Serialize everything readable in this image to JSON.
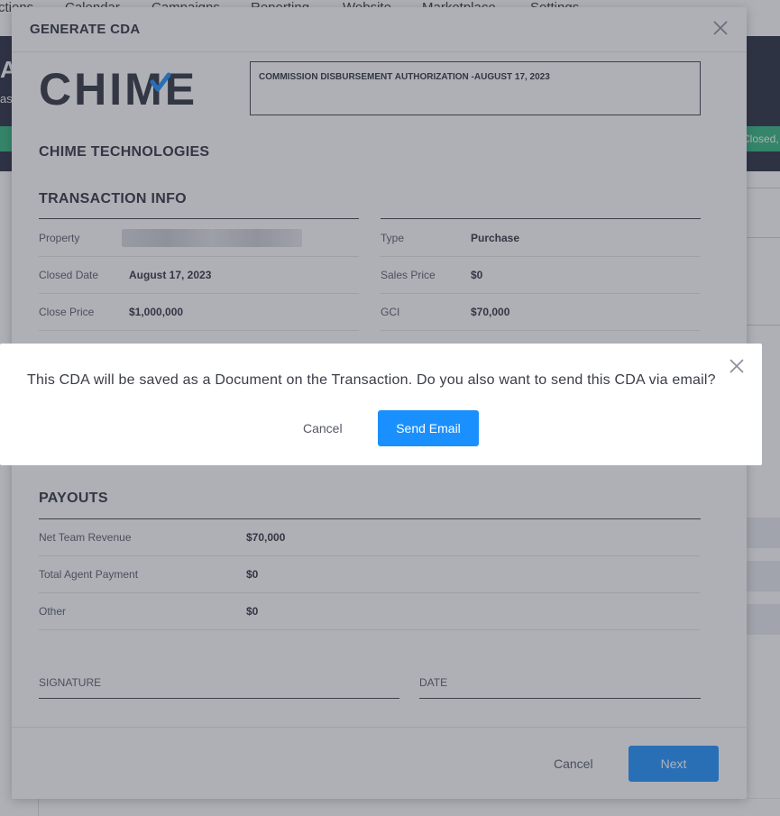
{
  "background": {
    "nav_items": [
      "ctions",
      "Calendar",
      "Campaigns",
      "Reporting",
      "Website",
      "Marketplace",
      "Settings"
    ],
    "header_letter": "A",
    "header_sub": "as",
    "status_badge": "Closed,"
  },
  "modal": {
    "title": "GENERATE CDA",
    "logo_text": "CHIME",
    "cda_heading": "COMMISSION DISBURSEMENT AUTHORIZATION -AUGUST 17, 2023",
    "company": "CHIME TECHNOLOGIES",
    "transaction": {
      "title": "TRANSACTION INFO",
      "left": [
        {
          "label": "Property",
          "value": ""
        },
        {
          "label": "Closed Date",
          "value": "August 17, 2023"
        },
        {
          "label": "Close Price",
          "value": "$1,000,000"
        }
      ],
      "right": [
        {
          "label": "Type",
          "value": "Purchase"
        },
        {
          "label": "Sales Price",
          "value": "$0"
        },
        {
          "label": "GCI",
          "value": "$70,000"
        }
      ]
    },
    "payouts": {
      "title": "PAYOUTS",
      "rows": [
        {
          "label": "Net Team Revenue",
          "value": "$70,000"
        },
        {
          "label": "Total Agent Payment",
          "value": "$0"
        },
        {
          "label": "Other",
          "value": "$0"
        }
      ]
    },
    "signature_label": "SIGNATURE",
    "date_label": "DATE",
    "footer": {
      "cancel": "Cancel",
      "next": "Next"
    }
  },
  "confirm": {
    "message": "This CDA will be saved as a Document on the Transaction. Do you also want to send this CDA via email?",
    "cancel": "Cancel",
    "send": "Send Email"
  },
  "colors": {
    "primary": "#1a90ff",
    "dark": "#24283c",
    "green": "#2db67c",
    "logo_check": "#1a90ff"
  }
}
